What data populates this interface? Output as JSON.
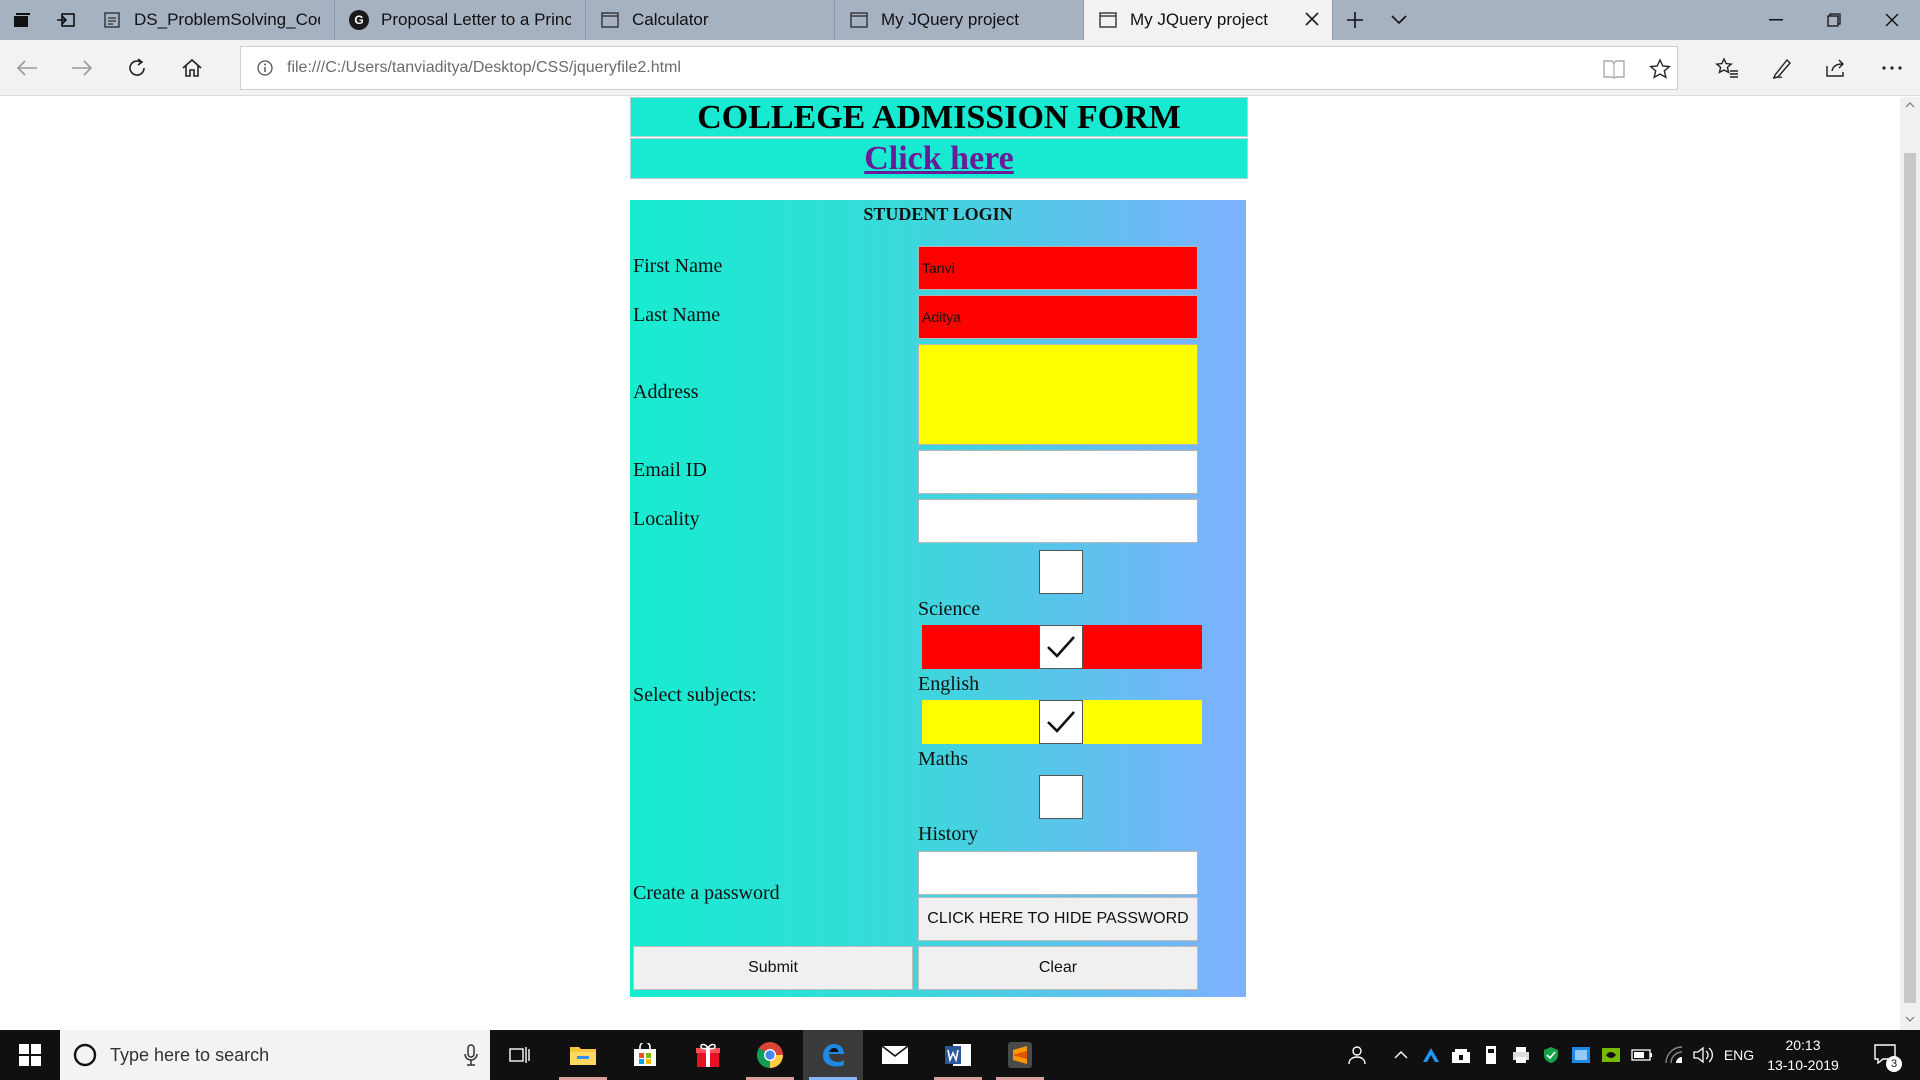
{
  "browser": {
    "tabs": [
      {
        "label": "DS_ProblemSolving_Coding",
        "icon": "document-icon"
      },
      {
        "label": "Proposal Letter to a Principa",
        "icon": "g-badge-icon",
        "badge": "G"
      },
      {
        "label": "Calculator",
        "icon": "page-icon"
      },
      {
        "label": "My JQuery project",
        "icon": "page-icon"
      },
      {
        "label": "My JQuery project",
        "icon": "page-icon",
        "active": true
      }
    ],
    "url": "file:///C:/Users/tanviaditya/Desktop/CSS/jqueryfile2.html"
  },
  "page": {
    "title": "COLLEGE ADMISSION FORM",
    "link": "Click here",
    "form": {
      "heading": "STUDENT LOGIN",
      "first_name_label": "First Name",
      "first_name_value": "Tanvi",
      "last_name_label": "Last Name",
      "last_name_value": "Aditya",
      "address_label": "Address",
      "email_label": "Email ID",
      "locality_label": "Locality",
      "subjects_label": "Select subjects:",
      "subjects": [
        {
          "name": "Science",
          "checked": false
        },
        {
          "name": "English",
          "checked": true
        },
        {
          "name": "Maths",
          "checked": true
        },
        {
          "name": "History",
          "checked": false
        }
      ],
      "password_label": "Create a password",
      "hide_password_button": "CLICK HERE TO HIDE PASSWORD",
      "submit_button": "Submit",
      "clear_button": "Clear"
    }
  },
  "taskbar": {
    "search_placeholder": "Type here to search",
    "language": "ENG",
    "time": "20:13",
    "date": "13-10-2019",
    "notification_count": "3"
  },
  "colors": {
    "banner": "#17ead0",
    "red_field": "#ff0000",
    "yellow_field": "#ffff00",
    "link": "#6a1b9a"
  }
}
